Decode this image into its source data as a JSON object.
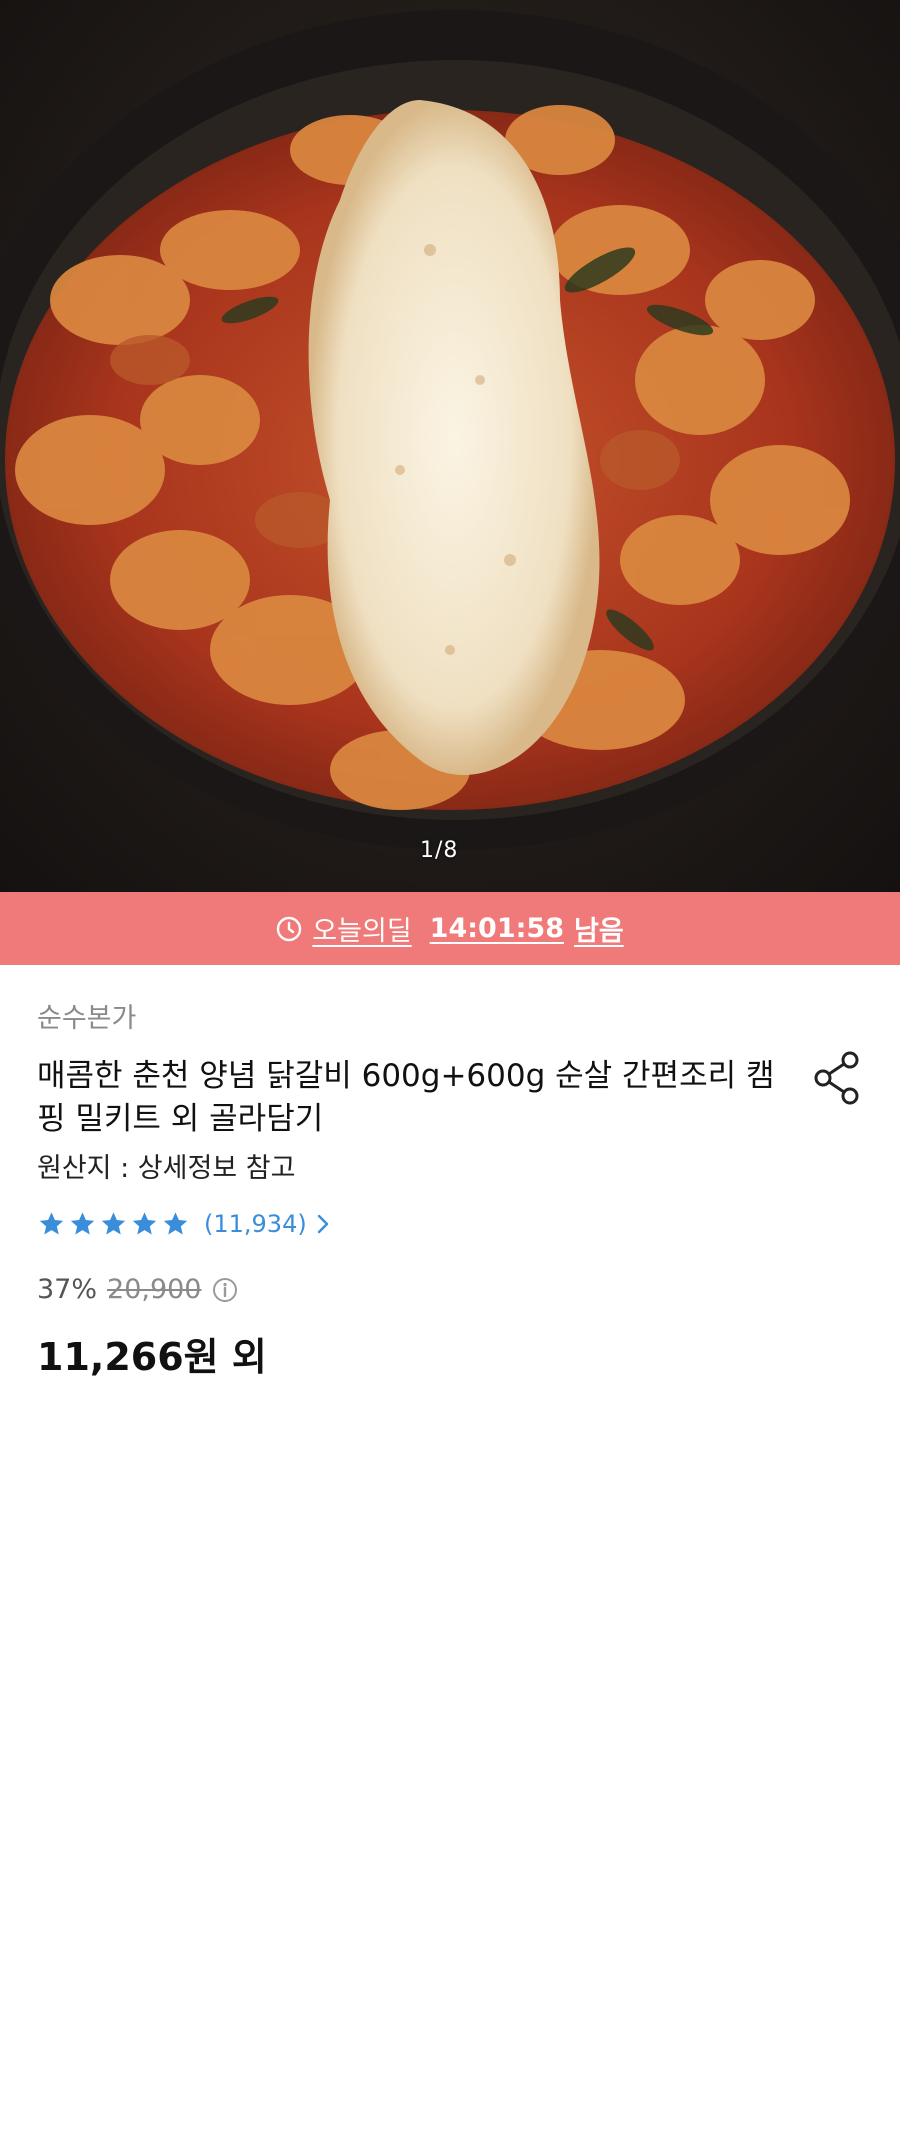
{
  "hero": {
    "image_description_icon": "food-photo",
    "counter": "1/8"
  },
  "deal": {
    "label": "오늘의딜",
    "time": "14:01:58",
    "suffix": "남음",
    "background": "#f07a79"
  },
  "product": {
    "seller": "순수본가",
    "title": "매콤한 춘천 양념 닭갈비 600g+600g 순살 간편조리 캠핑 밀키트 외 골라담기",
    "origin": "원산지 : 상세정보 참고",
    "rating_stars": 5,
    "review_count": "(11,934)",
    "discount": "37%",
    "original_price": "20,900",
    "price": "11,266원 외"
  },
  "colors": {
    "accent_blue": "#3a8ddb",
    "deal_pink": "#f07a79"
  }
}
